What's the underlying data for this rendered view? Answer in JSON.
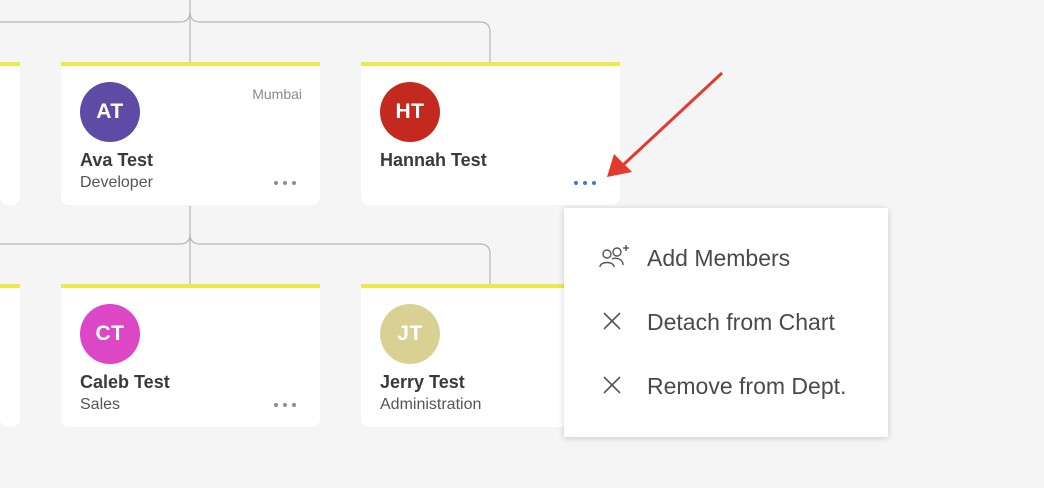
{
  "colors": {
    "card_accent": "#ede94a",
    "connector": "#b8b8b8",
    "annotation_arrow": "#e23b2e",
    "more_active": "#3d78d8"
  },
  "cards": [
    {
      "initials": "AT",
      "name": "Ava Test",
      "role": "Developer",
      "location": "Mumbai",
      "avatar_color": "#5e4ba6"
    },
    {
      "initials": "HT",
      "name": "Hannah Test",
      "role": "",
      "location": "",
      "avatar_color": "#c4291f"
    },
    {
      "initials": "CT",
      "name": "Caleb Test",
      "role": "Sales",
      "location": "",
      "avatar_color": "#db47c4"
    },
    {
      "initials": "JT",
      "name": "Jerry Test",
      "role": "Administration",
      "location": "",
      "avatar_color": "#d9d193"
    }
  ],
  "context_menu": {
    "items": [
      {
        "label": "Add Members",
        "icon": "add-members-icon"
      },
      {
        "label": "Detach from Chart",
        "icon": "close-icon"
      },
      {
        "label": "Remove from Dept.",
        "icon": "close-icon"
      }
    ]
  }
}
